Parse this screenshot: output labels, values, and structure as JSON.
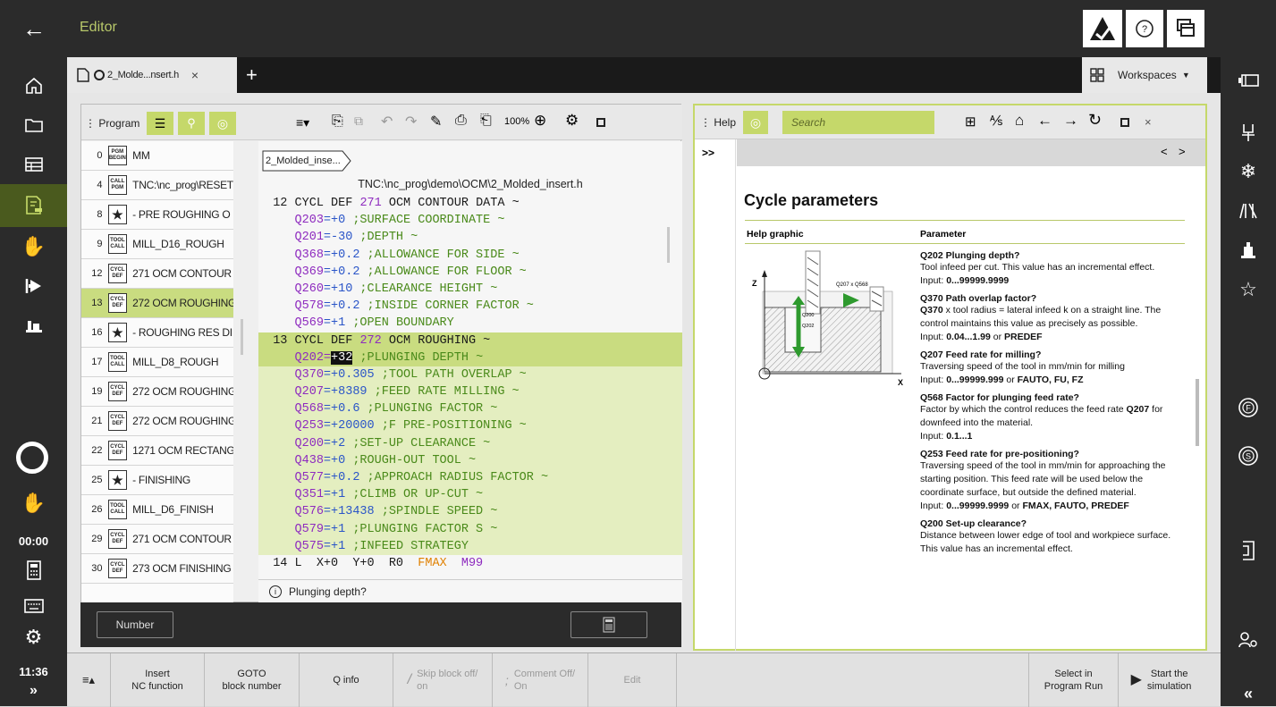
{
  "app": {
    "title": "Editor",
    "clock": "11:36",
    "time_counter": "00:00"
  },
  "tab": {
    "name": "2_Molde...nsert.h",
    "close": "×",
    "add": "+",
    "workspaces": "Workspaces"
  },
  "program": {
    "title": "Program",
    "rows": [
      {
        "n": "0",
        "badge": [
          "PGM",
          "BEGIN"
        ],
        "text": "MM"
      },
      {
        "n": "4",
        "badge": [
          "CALL",
          "PGM"
        ],
        "text": "TNC:\\nc_prog\\RESET"
      },
      {
        "n": "8",
        "badge": [
          "★"
        ],
        "text": "- PRE ROUGHING O"
      },
      {
        "n": "9",
        "badge": [
          "TOOL",
          "CALL"
        ],
        "text": "MILL_D16_ROUGH"
      },
      {
        "n": "12",
        "badge": [
          "CYCL",
          "DEF"
        ],
        "text": "271 OCM CONTOUR"
      },
      {
        "n": "13",
        "badge": [
          "CYCL",
          "DEF"
        ],
        "text": "272 OCM ROUGHING"
      },
      {
        "n": "16",
        "badge": [
          "★"
        ],
        "text": "- ROUGHING RES DI"
      },
      {
        "n": "17",
        "badge": [
          "TOOL",
          "CALL"
        ],
        "text": "MILL_D8_ROUGH"
      },
      {
        "n": "19",
        "badge": [
          "CYCL",
          "DEF"
        ],
        "text": "272 OCM ROUGHING"
      },
      {
        "n": "21",
        "badge": [
          "CYCL",
          "DEF"
        ],
        "text": "272 OCM ROUGHING"
      },
      {
        "n": "22",
        "badge": [
          "CYCL",
          "DEF"
        ],
        "text": "1271 OCM RECTANG"
      },
      {
        "n": "25",
        "badge": [
          "★"
        ],
        "text": "- FINISHING"
      },
      {
        "n": "26",
        "badge": [
          "TOOL",
          "CALL"
        ],
        "text": "MILL_D6_FINISH"
      },
      {
        "n": "29",
        "badge": [
          "CYCL",
          "DEF"
        ],
        "text": "271 OCM CONTOUR"
      },
      {
        "n": "30",
        "badge": [
          "CYCL",
          "DEF"
        ],
        "text": "273 OCM FINISHING"
      }
    ]
  },
  "editor": {
    "zoom": "100%",
    "breadcrumb": "2_Molded_inse...",
    "path": "TNC:\\nc_prog\\demo\\OCM\\2_Molded_insert.h",
    "status": "Plunging depth?",
    "number_label": "Number",
    "lines": [
      {
        "num": "12",
        "txt": "CYCL DEF ",
        "num2": "271",
        "rest": " OCM CONTOUR DATA ~",
        "kind": "head"
      },
      {
        "p": "Q203",
        "v": "=+0",
        "c": " ;SURFACE COORDINATE ~"
      },
      {
        "p": "Q201",
        "v": "=-30",
        "c": " ;DEPTH ~"
      },
      {
        "p": "Q368",
        "v": "=+0.2",
        "c": " ;ALLOWANCE FOR SIDE ~"
      },
      {
        "p": "Q369",
        "v": "=+0.2",
        "c": " ;ALLOWANCE FOR FLOOR ~"
      },
      {
        "p": "Q260",
        "v": "=+10",
        "c": " ;CLEARANCE HEIGHT ~"
      },
      {
        "p": "Q578",
        "v": "=+0.2",
        "c": " ;INSIDE CORNER FACTOR ~"
      },
      {
        "p": "Q569",
        "v": "=+1",
        "c": " ;OPEN BOUNDARY"
      },
      {
        "num": "13",
        "txt": "CYCL DEF ",
        "num2": "272",
        "rest": " OCM ROUGHING ~",
        "kind": "head"
      },
      {
        "p": "Q202",
        "eq": "=",
        "v": "+32",
        "c": " ;PLUNGING DEPTH ~",
        "active": true
      },
      {
        "p": "Q370",
        "v": "=+0.305",
        "c": " ;TOOL PATH OVERLAP ~"
      },
      {
        "p": "Q207",
        "v": "=+8389",
        "c": " ;FEED RATE MILLING ~"
      },
      {
        "p": "Q568",
        "v": "=+0.6",
        "c": " ;PLUNGING FACTOR ~"
      },
      {
        "p": "Q253",
        "v": "=+20000",
        "c": " ;F PRE-POSITIONING ~"
      },
      {
        "p": "Q200",
        "v": "=+2",
        "c": " ;SET-UP CLEARANCE ~"
      },
      {
        "p": "Q438",
        "v": "=+0",
        "c": " ;ROUGH-OUT TOOL ~"
      },
      {
        "p": "Q577",
        "v": "=+0.2",
        "c": " ;APPROACH RADIUS FACTOR ~"
      },
      {
        "p": "Q351",
        "v": "=+1",
        "c": " ;CLIMB OR UP-CUT ~"
      },
      {
        "p": "Q576",
        "v": "=+13438",
        "c": " ;SPINDLE SPEED ~"
      },
      {
        "p": "Q579",
        "v": "=+1",
        "c": " ;PLUNGING FACTOR S ~"
      },
      {
        "p": "Q575",
        "v": "=+1",
        "c": " ;INFEED STRATEGY"
      }
    ],
    "last_line": {
      "num": "14",
      "txt": "L  X+0  Y+0  R0  ",
      "o": "FMAX",
      "p": "  M99"
    }
  },
  "help": {
    "title": "Help",
    "search_placeholder": "Search",
    "expand": ">>",
    "heading": "Cycle parameters",
    "col1": "Help graphic",
    "col2": "Parameter",
    "graphic_labels": {
      "z": "Z",
      "x": "X",
      "q207": "Q207 x Q568",
      "q200": "Q200",
      "q202": "Q202"
    },
    "params": [
      {
        "q": "Q202 Plunging depth?",
        "t": "Tool infeed per cut. This value has an incremental effect.",
        "input_label": "Input: ",
        "input": "0...99999.9999"
      },
      {
        "q": "Q370 Path overlap factor?",
        "b": "Q370",
        "t": " x tool radius = lateral infeed k on a straight line. The control maintains this value as precisely as possible.",
        "input_label": "Input: ",
        "input": "0.04...1.99",
        "or": " or ",
        "extra": "PREDEF"
      },
      {
        "q": "Q207 Feed rate for milling?",
        "t": "Traversing speed of the tool in mm/min for milling",
        "input_label": "Input: ",
        "input": "0...99999.999",
        "or": " or ",
        "extra": "FAUTO, FU, FZ"
      },
      {
        "q": "Q568 Factor for plunging feed rate?",
        "t": "Factor by which the control reduces the feed rate ",
        "b2": "Q207",
        "t2": " for downfeed into the material.",
        "input_label": "Input: ",
        "input": "0.1...1"
      },
      {
        "q": "Q253 Feed rate for pre-positioning?",
        "t": "Traversing speed of the tool in mm/min for approaching the starting position. This feed rate will be used below the coordinate surface, but outside the defined material.",
        "input_label": "Input: ",
        "input": "0...99999.9999",
        "or": " or ",
        "extra": "FMAX, FAUTO, PREDEF"
      },
      {
        "q": "Q200 Set-up clearance?",
        "t": "Distance between lower edge of tool and workpiece surface. This value has an incremental effect."
      }
    ]
  },
  "bottom": {
    "insert": [
      "Insert",
      "NC function"
    ],
    "goto": [
      "GOTO",
      "block number"
    ],
    "qinfo": "Q info",
    "skip": [
      "Skip block off/",
      "on"
    ],
    "comment": [
      "Comment Off/",
      "On"
    ],
    "edit": "Edit",
    "select": [
      "Select in",
      "Program Run"
    ],
    "start": [
      "Start the",
      "simulation"
    ]
  }
}
